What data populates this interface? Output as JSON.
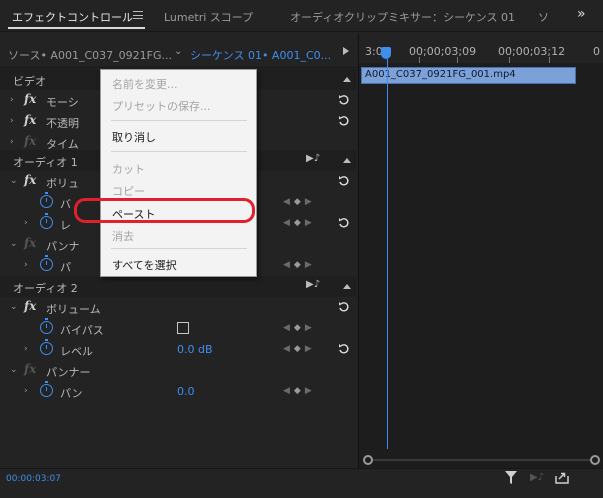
{
  "tabs": [
    {
      "label": "エフェクトコントロール",
      "active": true
    },
    {
      "label": "Lumetri スコープ",
      "active": false
    },
    {
      "label": "オーディオクリップミキサー：シーケンス 01",
      "active": false
    },
    {
      "label": "ソ",
      "active": false
    }
  ],
  "source_bar": {
    "source": "ソース• A001_C037_0921FG...",
    "sequence": "シーケンス 01• A001_C0..."
  },
  "effects": {
    "video_header": "ビデオ",
    "motion": "モーシ",
    "opacity": "不透明",
    "time": "タイム",
    "audio1_header": "オーディオ 1",
    "volume1": "ボリュ",
    "bypass1": "バ",
    "level1": "レ",
    "panner1": "パンナ",
    "pan1": "パ",
    "audio2_header": "オーディオ 2",
    "volume2": "ボリューム",
    "bypass2": "バイパス",
    "level2": "レベル",
    "level2_value": "0.0 dB",
    "panner2": "パンナー",
    "pan2": "パン",
    "pan2_value": "0.0"
  },
  "timeline": {
    "timecodes": [
      "3:06",
      "00;00;03;09",
      "00;00;03;12",
      "0"
    ],
    "clip_name": "A001_C037_0921FG_001.mp4",
    "current_time": "00:00:03:07"
  },
  "context_menu": {
    "items": [
      {
        "label": "名前を変更...",
        "enabled": false
      },
      {
        "label": "プリセットの保存...",
        "enabled": false
      },
      {
        "label": "取り消し",
        "enabled": true
      },
      {
        "label": "カット",
        "enabled": false
      },
      {
        "label": "コピー",
        "enabled": false
      },
      {
        "label": "ペースト",
        "enabled": true,
        "highlighted": true
      },
      {
        "label": "消去",
        "enabled": false
      },
      {
        "label": "すべてを選択",
        "enabled": true
      }
    ]
  },
  "colors": {
    "accent": "#3e8ef0",
    "highlight_ring": "#e0202a",
    "clip": "#7ca1d8"
  }
}
